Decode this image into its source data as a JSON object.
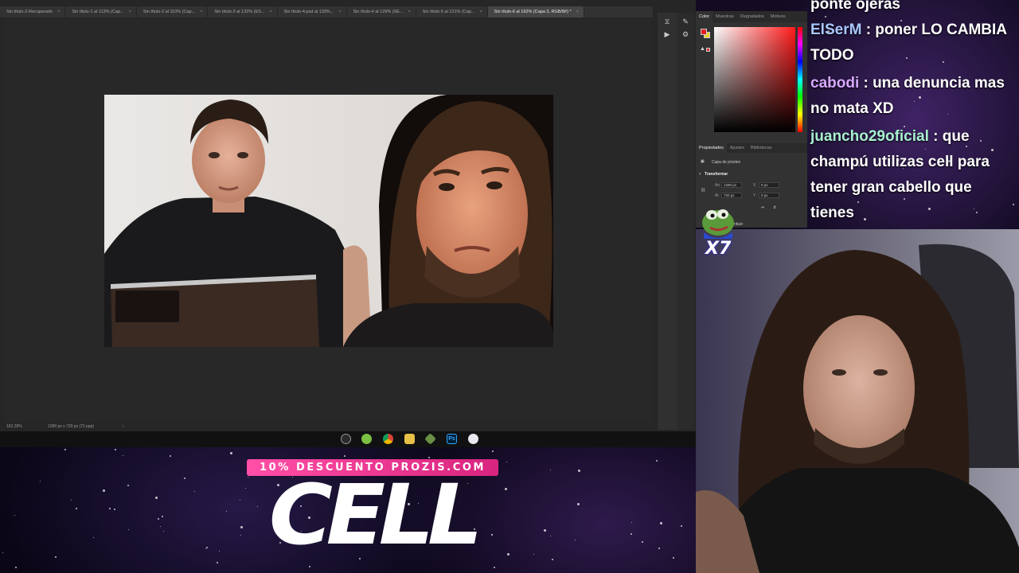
{
  "photoshop": {
    "tabs": [
      {
        "label": "Sin título-2-Recuperado"
      },
      {
        "label": "Sin título-1 al 113% (Cap..."
      },
      {
        "label": "Sin título-2 al 110% (Cap..."
      },
      {
        "label": "Sin título-3 al 132% (ES..."
      },
      {
        "label": "Sin título-4.psd al 133%..."
      },
      {
        "label": "Sin título-4 al 129% (SE..."
      },
      {
        "label": "Sin título-5 al 121% (Cap..."
      },
      {
        "label": "Sin título-6 al 162% (Capa 3, RGB/8#) *",
        "active": true
      }
    ],
    "tab_close_glyph": "×",
    "status": {
      "zoom": "162,39%",
      "doc_size": "1280 px x 720 px (72 ppp)",
      "arrow": "›"
    },
    "color_panel": {
      "tabs": [
        "Color",
        "Muestras",
        "Degradados",
        "Motivos"
      ],
      "foreground": "#e02020",
      "background": "#e9d02c"
    },
    "properties_panel": {
      "tabs": [
        "Propiedades",
        "Ajustes",
        "Bibliotecas"
      ],
      "layer_type": "Capa de píxeles",
      "section": "Transformar",
      "fields": {
        "an_label": "An",
        "an_value": "1280 px",
        "al_label": "Al",
        "al_value": "720 px",
        "x_label": "X",
        "x_value": "0 px",
        "y_label": "Y",
        "y_value": "0 px"
      },
      "partial_label": "ribuir"
    },
    "taskbar_icons": [
      "clock-icon",
      "android-icon",
      "chrome-icon",
      "folder-icon",
      "xbox-icon",
      "photoshop-icon",
      "app-icon"
    ]
  },
  "promo": {
    "code_text": "10% DESCUENTO PROZIS.COM",
    "brand_text": "CELL"
  },
  "chat": {
    "messages": [
      {
        "user": "",
        "text": "ponte ojeras",
        "color": "#ffffff"
      },
      {
        "user": "ElSerM",
        "text": " : poner LO CAMBIA TODO",
        "color": "#a9c8ff"
      },
      {
        "user": "cabodi",
        "text": " : una denuncia mas no mata XD",
        "color": "#d7a8ff"
      },
      {
        "user": "juancho29oficial",
        "text": " : que champú utilizas cell para tener gran cabello que tienes",
        "color": "#a8f0d0"
      }
    ]
  },
  "emote": {
    "count": "X7"
  }
}
